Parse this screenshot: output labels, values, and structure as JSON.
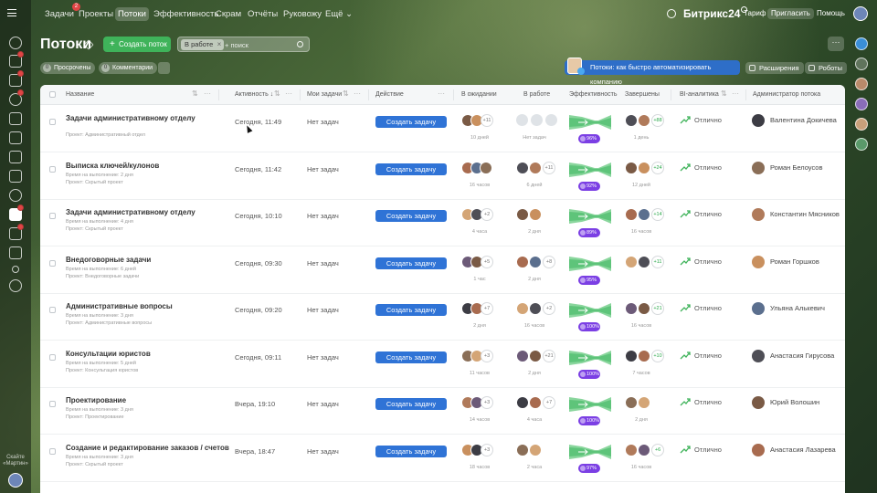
{
  "topnav": {
    "items": [
      {
        "label": "Задачи",
        "badge": "2"
      },
      {
        "label": "Проекты"
      },
      {
        "label": "Потоки",
        "active": true
      },
      {
        "label": "Эффективность"
      },
      {
        "label": "Скрам"
      },
      {
        "label": "Отчёты"
      },
      {
        "label": "Руковожу"
      },
      {
        "label": "Ещё"
      }
    ],
    "logo": "Битрикс24",
    "tariff": "Тариф",
    "invite": "Пригласить",
    "help": "Помощь"
  },
  "left_rail": {
    "scan_text_1": "Скайте",
    "scan_text_2": "«Мартин»"
  },
  "page": {
    "title": "Потоки",
    "create_label": "Создать поток",
    "filter_tag": "В работе",
    "search_placeholder": "+ поиск",
    "more_label": "···"
  },
  "subbar": {
    "overdue": {
      "count": "0",
      "label": "Просрочены"
    },
    "comments": {
      "count": "0",
      "label": "Комментарии"
    },
    "promo": "Потоки: как быстро автоматизировать компанию",
    "extensions": "Расширения",
    "robots": "Роботы"
  },
  "table": {
    "columns": {
      "name": "Название",
      "activity": "Активность",
      "my_tasks": "Мои задачи",
      "action": "Действие",
      "waiting": "В ожидании",
      "in_work": "В работе",
      "efficiency": "Эффективность",
      "completed": "Завершены",
      "bi": "BI-аналитика",
      "admin": "Администратор потока"
    },
    "rows": [
      {
        "title": "Задачи административному отделу",
        "sub1": "",
        "sub2": "Проект: Административный отдел",
        "activity": "Сегодня, 11:49",
        "my_tasks": "Нет задач",
        "btn": "Создать задачу",
        "wait_more": "+11",
        "wait_time": "10 дней",
        "work_more": "",
        "work_time": "Нет задач",
        "eff": "96%",
        "done_more": "+88",
        "done_time": "1 день",
        "bi": "Отлично",
        "admin": "Валентина Докичева",
        "work_empty": true
      },
      {
        "title": "Выписка ключей/кулонов",
        "sub1": "Время на выполнение: 2 дня",
        "sub2": "Проект: Скрытый проект",
        "activity": "Сегодня, 11:42",
        "my_tasks": "Нет задач",
        "btn": "Создать задачу",
        "wait_more": "",
        "wait_time": "16 часов",
        "work_more": "+11",
        "work_time": "6 дней",
        "eff": "92%",
        "done_more": "+24",
        "done_time": "12 дней",
        "bi": "Отлично",
        "admin": "Роман Белоусов"
      },
      {
        "title": "Задачи административному отделу",
        "sub1": "Время на выполнение: 4 дня",
        "sub2": "Проект: Скрытый проект",
        "activity": "Сегодня, 10:10",
        "my_tasks": "Нет задач",
        "btn": "Создать задачу",
        "wait_more": "+2",
        "wait_time": "4 часа",
        "work_more": "",
        "work_time": "2 дня",
        "eff": "89%",
        "done_more": "+14",
        "done_time": "16 часов",
        "bi": "Отлично",
        "admin": "Константин Мясников"
      },
      {
        "title": "Внедоговорные задачи",
        "sub1": "Время на выполнение: 6 дней",
        "sub2": "Проект: Внедоговорные задачи",
        "activity": "Сегодня, 09:30",
        "my_tasks": "Нет задач",
        "btn": "Создать задачу",
        "wait_more": "+5",
        "wait_time": "1 час",
        "work_more": "+8",
        "work_time": "2 дня",
        "eff": "95%",
        "done_more": "+11",
        "done_time": "",
        "bi": "Отлично",
        "admin": "Роман Горшков"
      },
      {
        "title": "Административные вопросы",
        "sub1": "Время на выполнение: 3 дня",
        "sub2": "Проект: Административные вопросы",
        "activity": "Сегодня, 09:20",
        "my_tasks": "Нет задач",
        "btn": "Создать задачу",
        "wait_more": "+7",
        "wait_time": "2 дня",
        "work_more": "+2",
        "work_time": "16 часов",
        "eff": "100%",
        "done_more": "+21",
        "done_time": "16 часов",
        "bi": "Отлично",
        "admin": "Ульяна Алькевич"
      },
      {
        "title": "Консультации юристов",
        "sub1": "Время на выполнение: 5 дней",
        "sub2": "Проект: Консультация юристов",
        "activity": "Сегодня, 09:11",
        "my_tasks": "Нет задач",
        "btn": "Создать задачу",
        "wait_more": "+3",
        "wait_time": "11 часов",
        "work_more": "+21",
        "work_time": "2 дня",
        "eff": "100%",
        "done_more": "+10",
        "done_time": "7 часов",
        "bi": "Отлично",
        "admin": "Анастасия Гирусова"
      },
      {
        "title": "Проектирование",
        "sub1": "Время на выполнение: 3 дня",
        "sub2": "Проект: Проектирование",
        "activity": "Вчера, 19:10",
        "my_tasks": "Нет задач",
        "btn": "Создать задачу",
        "wait_more": "+3",
        "wait_time": "14 часов",
        "work_more": "+7",
        "work_time": "4 часа",
        "eff": "100%",
        "done_more": "",
        "done_time": "2 дня",
        "bi": "Отлично",
        "admin": "Юрий Волошин"
      },
      {
        "title": "Создание и редактирование заказов / счетов",
        "sub1": "Время на выполнение: 3 дня",
        "sub2": "Проект: Скрытый проект",
        "activity": "Вчера, 18:47",
        "my_tasks": "Нет задач",
        "btn": "Создать задачу",
        "wait_more": "+3",
        "wait_time": "18 часов",
        "work_more": "",
        "work_time": "2 часа",
        "eff": "97%",
        "done_more": "+6",
        "done_time": "16 часов",
        "bi": "Отлично",
        "admin": "Анастасия Лазарева"
      }
    ]
  },
  "colors": {
    "accent_blue": "#2f73d6",
    "accent_green": "#3fb35a",
    "efficiency_purple": "#7b3fe4"
  }
}
